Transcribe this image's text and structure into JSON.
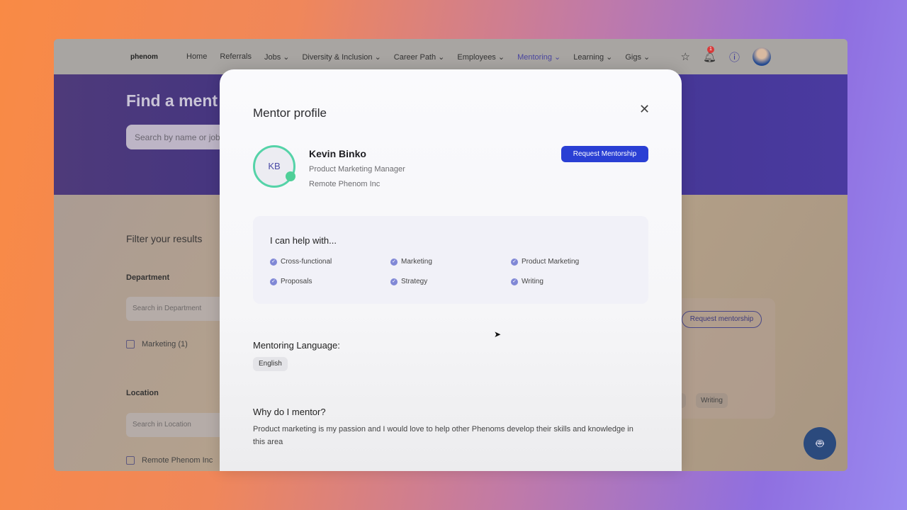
{
  "nav": {
    "logo": "phenom",
    "items": [
      {
        "label": "Home"
      },
      {
        "label": "Referrals"
      },
      {
        "label": "Jobs ⌄"
      },
      {
        "label": "Diversity & Inclusion ⌄"
      },
      {
        "label": "Career Path ⌄"
      },
      {
        "label": "Employees ⌄"
      },
      {
        "label": "Mentoring ⌄",
        "active": true
      },
      {
        "label": "Learning ⌄"
      },
      {
        "label": "Gigs ⌄"
      }
    ],
    "notification_count": "1"
  },
  "hero": {
    "title": "Find a ment",
    "search_placeholder": "Search by name or job"
  },
  "filters": {
    "title": "Filter your results",
    "department": {
      "label": "Department",
      "placeholder": "Search in Department",
      "option": "Marketing (1)"
    },
    "location": {
      "label": "Location",
      "placeholder": "Search in Location",
      "option": "Remote Phenom Inc"
    }
  },
  "background_card": {
    "button": "Request mentorship",
    "tags": [
      "y",
      "Writing"
    ]
  },
  "modal": {
    "title": "Mentor profile",
    "initials": "KB",
    "name": "Kevin Binko",
    "role": "Product Marketing Manager",
    "org": "Remote Phenom Inc",
    "request_button": "Request Mentorship",
    "help_title": "I can help with...",
    "skills": [
      "Cross-functional",
      "Marketing",
      "Product Marketing",
      "Proposals",
      "Strategy",
      "Writing"
    ],
    "language_label": "Mentoring Language:",
    "language": "English",
    "why_label": "Why do I mentor?",
    "why_text": "Product marketing is my passion and I would love to help other Phenoms develop their skills and knowledge in this area"
  },
  "colors": {
    "accent": "#2a3fd4",
    "status": "#4fcf98"
  }
}
